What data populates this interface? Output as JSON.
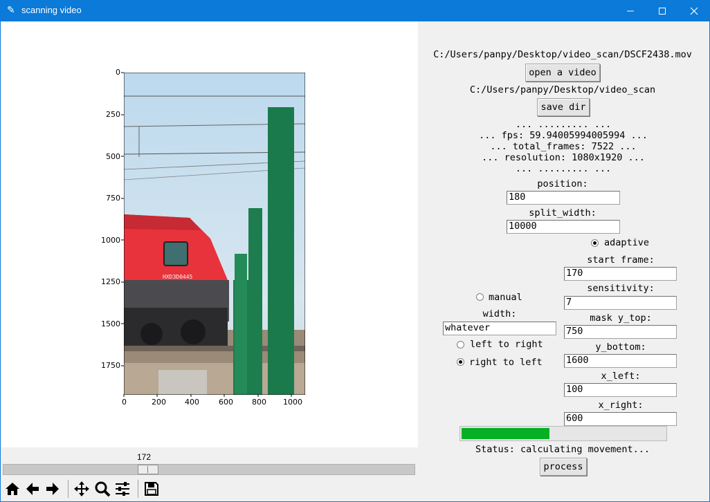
{
  "window": {
    "title": "scanning video",
    "app_icon": "feather-icon"
  },
  "plot": {
    "y_ticks": [
      "0",
      "250",
      "500",
      "750",
      "1000",
      "1250",
      "1500",
      "1750"
    ],
    "x_ticks": [
      "0",
      "200",
      "400",
      "600",
      "800",
      "1000"
    ],
    "image_text": "HXD3D0445"
  },
  "slider": {
    "value": "172"
  },
  "toolbar": {
    "icons": [
      "home-icon",
      "back-arrow-icon",
      "forward-arrow-icon",
      "pan-icon",
      "zoom-icon",
      "configure-subplots-icon",
      "save-icon"
    ]
  },
  "panel": {
    "video_path": "C:/Users/panpy/Desktop/video_scan/DSCF2438.mov",
    "open_video_label": "open a video",
    "save_dir_path": "C:/Users/panpy/Desktop/video_scan",
    "save_dir_label": "save dir",
    "info": [
      "... ......... ...",
      "... fps: 59.94005994005994 ...",
      "... total_frames: 7522 ...",
      "... resolution: 1080x1920 ...",
      "... ......... ..."
    ],
    "position_label": "position:",
    "position_value": "180",
    "split_width_label": "split_width:",
    "split_width_value": "10000",
    "adaptive_label": "adaptive",
    "manual_label": "manual",
    "mode_selected": "adaptive",
    "width_label": "width:",
    "width_value": "whatever",
    "left_to_right_label": "left to right",
    "right_to_left_label": "right to left",
    "direction_selected": "right to left",
    "start_frame_label": "start frame:",
    "start_frame_value": "170",
    "sensitivity_label": "sensitivity:",
    "sensitivity_value": "7",
    "mask_y_top_label": "mask y_top:",
    "mask_y_top_value": "750",
    "y_bottom_label": "y_bottom:",
    "y_bottom_value": "1600",
    "x_left_label": "x_left:",
    "x_left_value": "100",
    "x_right_label": "x_right:",
    "x_right_value": "600",
    "progress": 0.43,
    "progress_color": "#06b025",
    "status": "Status: calculating movement...",
    "process_label": "process"
  }
}
